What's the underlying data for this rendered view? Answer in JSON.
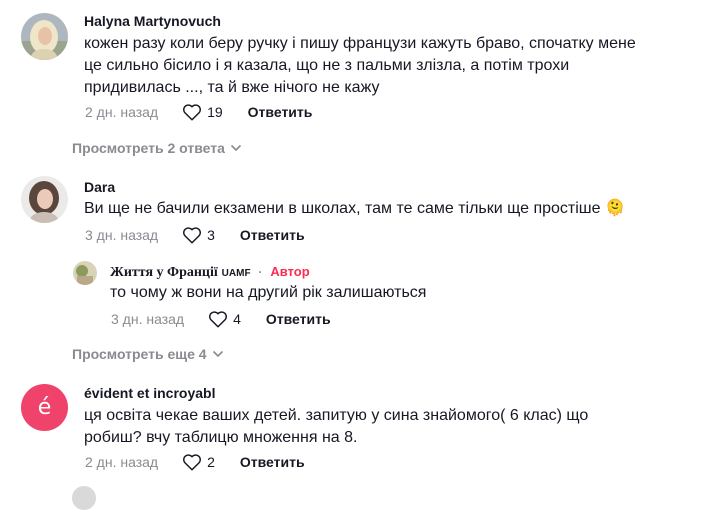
{
  "comments": [
    {
      "author": "Halyna Martynovuch",
      "lines": [
        "кожен разу коли беру ручку і пишу французи кажуть браво, спочатку мене",
        "це сильно бісило і я казала, що не з пальми злізла, а потім трохи",
        "придивилась ..., та й вже нічого не кажу"
      ],
      "date": "2 дн. назад",
      "likes": "19",
      "reply_label": "Ответить",
      "view_replies": "Просмотреть 2 ответа"
    },
    {
      "author": "Dara",
      "lines": [
        "Ви ще не бачили екзамени в школах, там те саме тільки ще простіше 🫠"
      ],
      "date": "3 дн. назад",
      "likes": "3",
      "reply_label": "Ответить"
    },
    {
      "author": "évident et incroyabl",
      "avatar_letter": "é",
      "avatar_color": "#f0436b",
      "lines": [
        "ця освіта чекае ваших детей. запитую у сина знайомого( 6 клас) що",
        "робиш? вчу таблицю множення на 8."
      ],
      "date": "2 дн. назад",
      "likes": "2",
      "reply_label": "Ответить"
    }
  ],
  "reply": {
    "author": "Життя у Франції",
    "author_suffix": "UAMF",
    "separator": "·",
    "badge": "Автор",
    "text": "то чому ж вони на другий рік залишаються",
    "date": "3 дн. назад",
    "likes": "4",
    "reply_label": "Ответить"
  },
  "view_more_label": "Просмотреть еще 4",
  "colors": {
    "muted": "#8a8b91",
    "text": "#161823",
    "accent": "#fe2c55"
  }
}
